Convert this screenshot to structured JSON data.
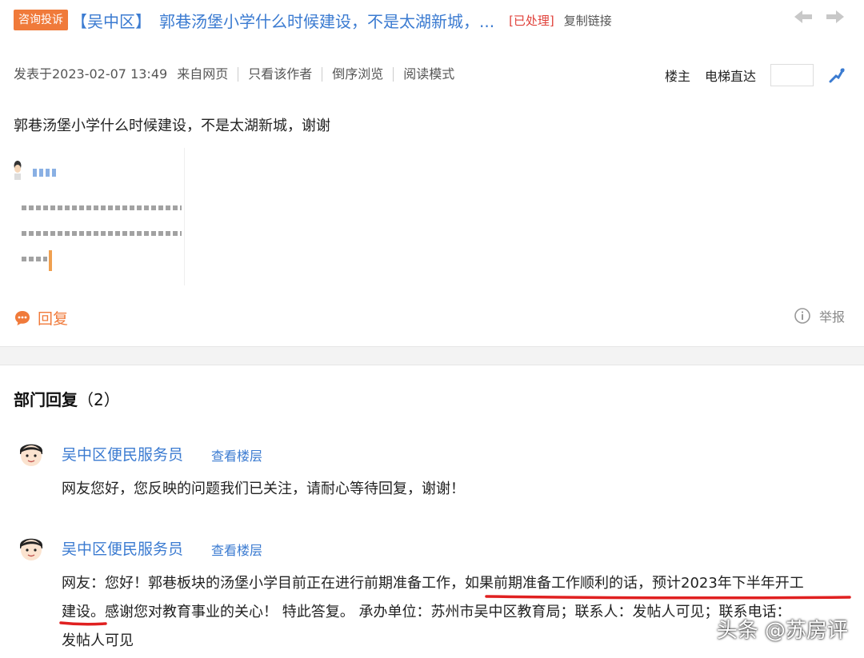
{
  "header": {
    "tag": "咨询投诉",
    "district": "【吴中区】",
    "title": "郭巷汤堡小学什么时候建设，不是太湖新城，...",
    "status": "[已处理]",
    "copy_link": "复制链接"
  },
  "meta": {
    "posted": "发表于2023-02-07 13:49",
    "source": "来自网页",
    "only_author": "只看该作者",
    "reverse": "倒序浏览",
    "read_mode": "阅读模式",
    "floor_owner": "楼主",
    "elevator": "电梯直达"
  },
  "post": {
    "body": "郭巷汤堡小学什么时候建设，不是太湖新城，谢谢"
  },
  "actions": {
    "reply": "回复",
    "report": "举报"
  },
  "replies_section": {
    "title": "部门回复",
    "count": "（2）"
  },
  "replies": [
    {
      "name": "吴中区便民服务员",
      "floor_link": "查看楼层",
      "text": "网友您好，您反映的问题我们已关注，请耐心等待回复，谢谢！"
    },
    {
      "name": "吴中区便民服务员",
      "floor_link": "查看楼层",
      "text_line1": "网友：您好！郭巷板块的汤堡小学目前正在进行前期准备工作，如果前期准备工作顺利的话，预计2023年下半年开工",
      "text_line2": "建设。感谢您对教育事业的关心！ 特此答复。 承办单位：苏州市吴中区教育局；联系人：发帖人可见；联系电话：",
      "text_line3": "发帖人可见"
    }
  ],
  "watermark": "头条 @苏房评",
  "colors": {
    "accent_blue": "#3b7bd1",
    "tag_orange": "#f07a3a",
    "status_red": "#e0413a",
    "underline_red": "#e02020"
  }
}
